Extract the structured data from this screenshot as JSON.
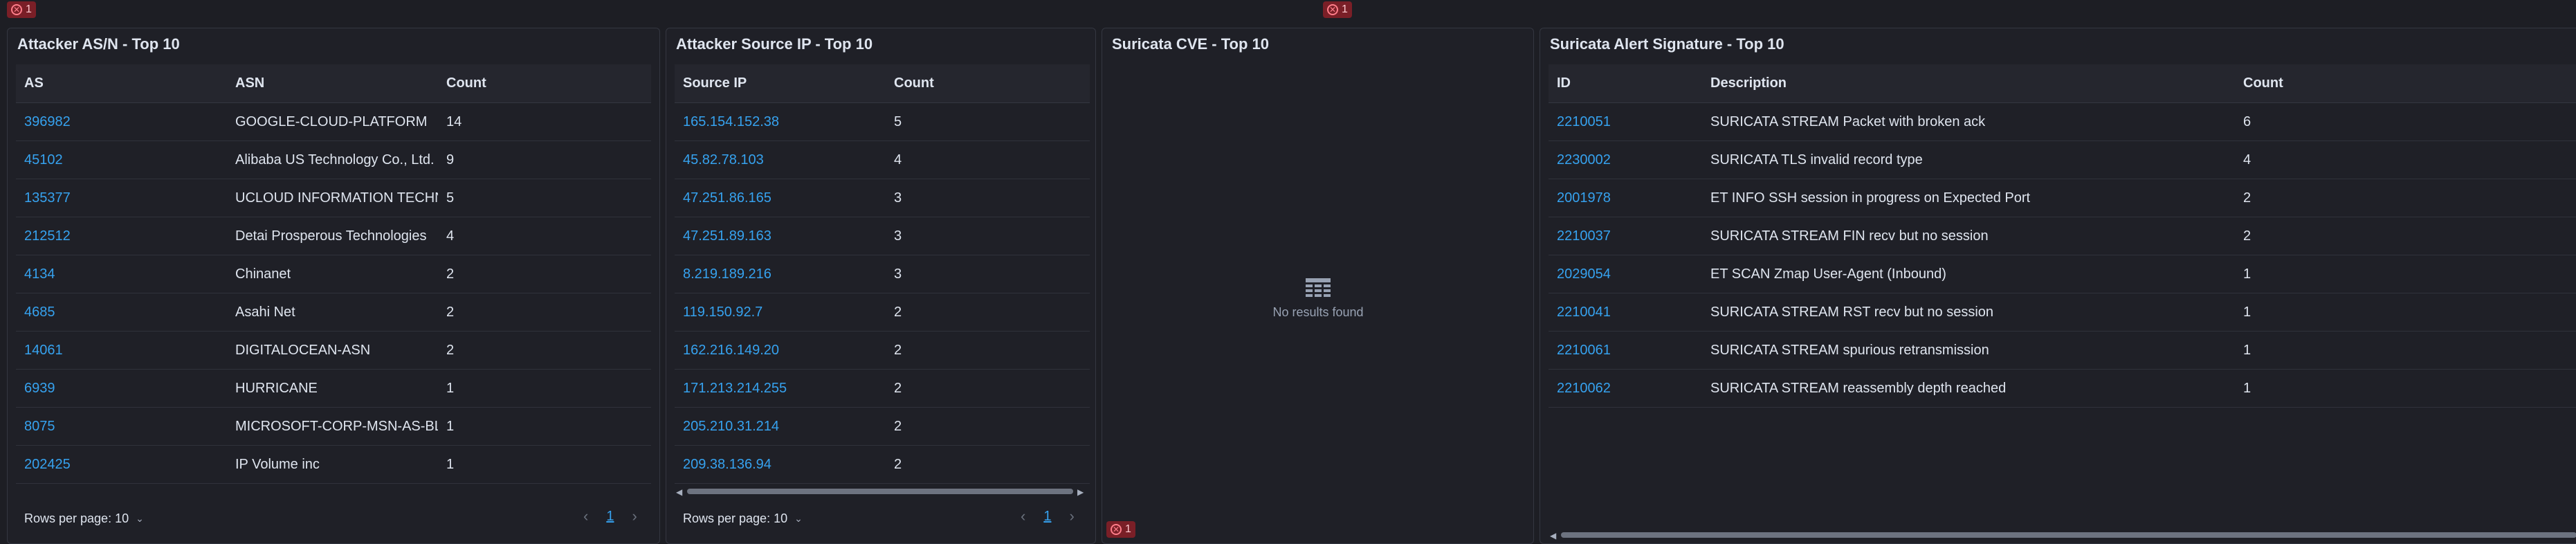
{
  "errors": {
    "count_left": "1",
    "count_mid": "1",
    "count_cve": "1"
  },
  "as_panel": {
    "title": "Attacker AS/N - Top 10",
    "columns": [
      "AS",
      "ASN",
      "Count"
    ],
    "rows": [
      {
        "as": "396982",
        "asn": "GOOGLE-CLOUD-PLATFORM",
        "count": "14"
      },
      {
        "as": "45102",
        "asn": "Alibaba US Technology Co., Ltd.",
        "count": "9"
      },
      {
        "as": "135377",
        "asn": "UCLOUD INFORMATION TECHNOLOGY",
        "count": "5"
      },
      {
        "as": "212512",
        "asn": "Detai Prosperous Technologies",
        "count": "4"
      },
      {
        "as": "4134",
        "asn": "Chinanet",
        "count": "2"
      },
      {
        "as": "4685",
        "asn": "Asahi Net",
        "count": "2"
      },
      {
        "as": "14061",
        "asn": "DIGITALOCEAN-ASN",
        "count": "2"
      },
      {
        "as": "6939",
        "asn": "HURRICANE",
        "count": "1"
      },
      {
        "as": "8075",
        "asn": "MICROSOFT-CORP-MSN-AS-BLOCK",
        "count": "1"
      },
      {
        "as": "202425",
        "asn": "IP Volume inc",
        "count": "1"
      }
    ],
    "rows_per_page": "Rows per page: 10",
    "page": "1"
  },
  "ip_panel": {
    "title": "Attacker Source IP - Top 10",
    "columns": [
      "Source IP",
      "Count"
    ],
    "rows": [
      {
        "ip": "165.154.152.38",
        "count": "5"
      },
      {
        "ip": "45.82.78.103",
        "count": "4"
      },
      {
        "ip": "47.251.86.165",
        "count": "3"
      },
      {
        "ip": "47.251.89.163",
        "count": "3"
      },
      {
        "ip": "8.219.189.216",
        "count": "3"
      },
      {
        "ip": "119.150.92.7",
        "count": "2"
      },
      {
        "ip": "162.216.149.20",
        "count": "2"
      },
      {
        "ip": "171.213.214.255",
        "count": "2"
      },
      {
        "ip": "205.210.31.214",
        "count": "2"
      },
      {
        "ip": "209.38.136.94",
        "count": "2"
      }
    ],
    "rows_per_page": "Rows per page: 10",
    "page": "1"
  },
  "cve_panel": {
    "title": "Suricata CVE - Top 10",
    "empty_text": "No results found"
  },
  "sig_panel": {
    "title": "Suricata Alert Signature - Top 10",
    "columns": [
      "ID",
      "Description",
      "Count"
    ],
    "rows": [
      {
        "id": "2210051",
        "desc": "SURICATA STREAM Packet with broken ack",
        "count": "6"
      },
      {
        "id": "2230002",
        "desc": "SURICATA TLS invalid record type",
        "count": "4"
      },
      {
        "id": "2001978",
        "desc": "ET INFO SSH session in progress on Expected Port",
        "count": "2"
      },
      {
        "id": "2210037",
        "desc": "SURICATA STREAM FIN recv but no session",
        "count": "2"
      },
      {
        "id": "2029054",
        "desc": "ET SCAN Zmap User-Agent (Inbound)",
        "count": "1"
      },
      {
        "id": "2210041",
        "desc": "SURICATA STREAM RST recv but no session",
        "count": "1"
      },
      {
        "id": "2210061",
        "desc": "SURICATA STREAM spurious retransmission",
        "count": "1"
      },
      {
        "id": "2210062",
        "desc": "SURICATA STREAM reassembly depth reached",
        "count": "1"
      }
    ]
  }
}
